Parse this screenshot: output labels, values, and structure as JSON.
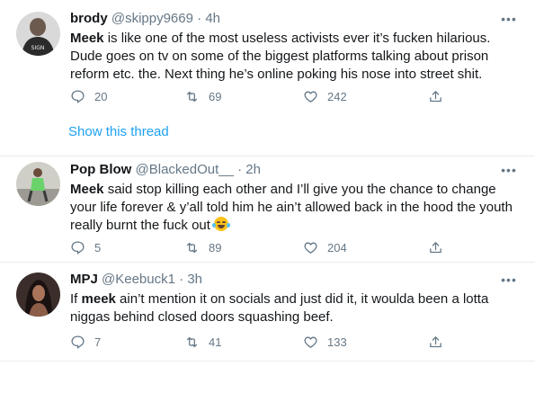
{
  "tweets": [
    {
      "name": "brody",
      "handle": "@skippy9669",
      "dot": "·",
      "time": "4h",
      "avatar_icon": "avatar-photo",
      "text_bold": "Meek",
      "text_rest": " is like one of the most useless activists ever it’s f⁠ucken hilarious. Dude goes on tv on some of the biggest platforms talking about prison reform etc. the. Next thing he’s online poking his nose into street shit.",
      "replies": "20",
      "retweets": "69",
      "likes": "242",
      "show_thread": "Show this thread"
    },
    {
      "name": "Pop Blow",
      "handle": "@BlackedOut__",
      "dot": "·",
      "time": "2h",
      "avatar_icon": "avatar-photo",
      "text_bold": "Meek",
      "text_rest": " said stop killing each other and I’ll give you the chance to change your life forever & y’all told him he ain’t allowed back in the hood the youth really burnt the fuck out",
      "emoji": "😂",
      "replies": "5",
      "retweets": "89",
      "likes": "204"
    },
    {
      "name": "MPJ",
      "handle": "@Keebuck1",
      "dot": "·",
      "time": "3h",
      "avatar_icon": "avatar-photo",
      "text_pre": "If ",
      "text_bold": "meek",
      "text_rest": " ain’t mention it on socials and just did it, it woulda been a lotta niggas behind closed doors squashing beef.",
      "replies": "7",
      "retweets": "41",
      "likes": "133"
    }
  ],
  "icons": {
    "more": "more-icon",
    "reply": "reply-icon",
    "retweet": "retweet-icon",
    "like": "heart-icon",
    "share": "share-icon"
  },
  "colors": {
    "link": "#1da1f2",
    "secondary": "#657786",
    "border": "#e6ecf0"
  }
}
